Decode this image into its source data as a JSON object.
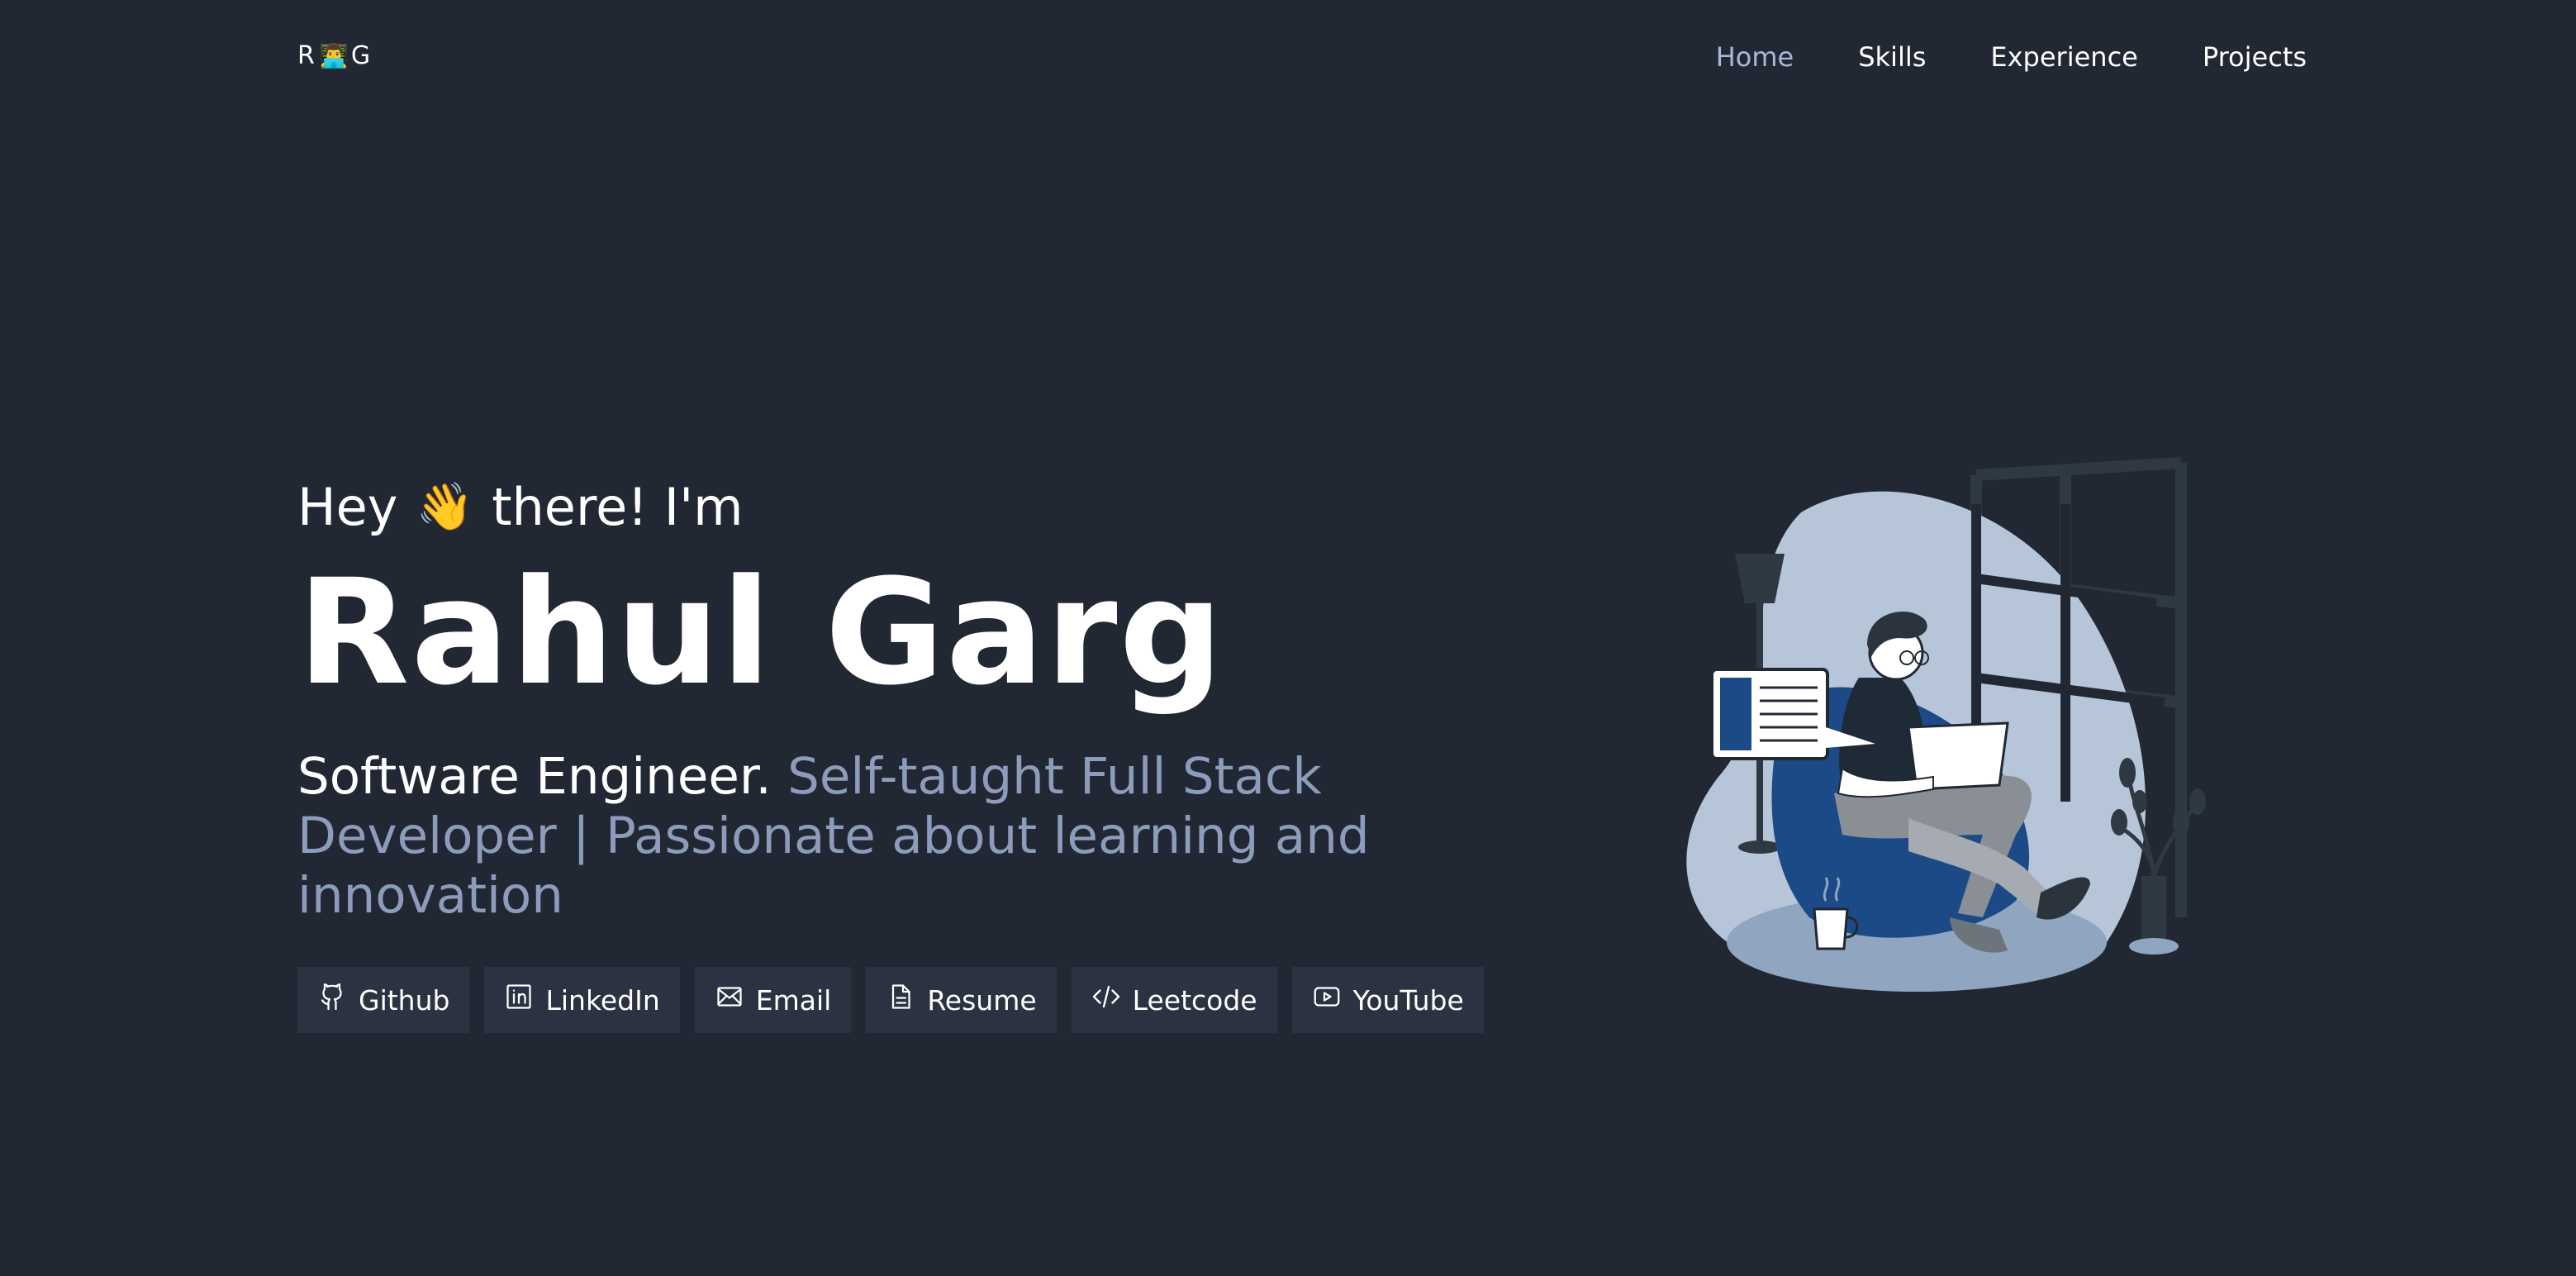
{
  "logo": {
    "left": "R",
    "emoji": "👨‍💻",
    "right": "G"
  },
  "nav": {
    "items": [
      {
        "label": "Home"
      },
      {
        "label": "Skills"
      },
      {
        "label": "Experience"
      },
      {
        "label": "Projects"
      }
    ]
  },
  "hero": {
    "greeting_before": "Hey",
    "greeting_emoji": "👋",
    "greeting_after": "there! I'm",
    "name": "Rahul Garg",
    "tagline_main": "Software Engineer.",
    "tagline_accent": "Self-taught Full Stack Developer | Passionate about learning and innovation"
  },
  "links": [
    {
      "label": "Github",
      "icon": "github-icon"
    },
    {
      "label": "LinkedIn",
      "icon": "linkedin-icon"
    },
    {
      "label": "Email",
      "icon": "mail-icon"
    },
    {
      "label": "Resume",
      "icon": "document-icon"
    },
    {
      "label": "Leetcode",
      "icon": "code-icon"
    },
    {
      "label": "YouTube",
      "icon": "youtube-icon"
    }
  ],
  "colors": {
    "background": "#222833",
    "accent_text": "#8d9cbb",
    "nav_active": "#a9b8d6",
    "button_bg": "#2b3241"
  }
}
